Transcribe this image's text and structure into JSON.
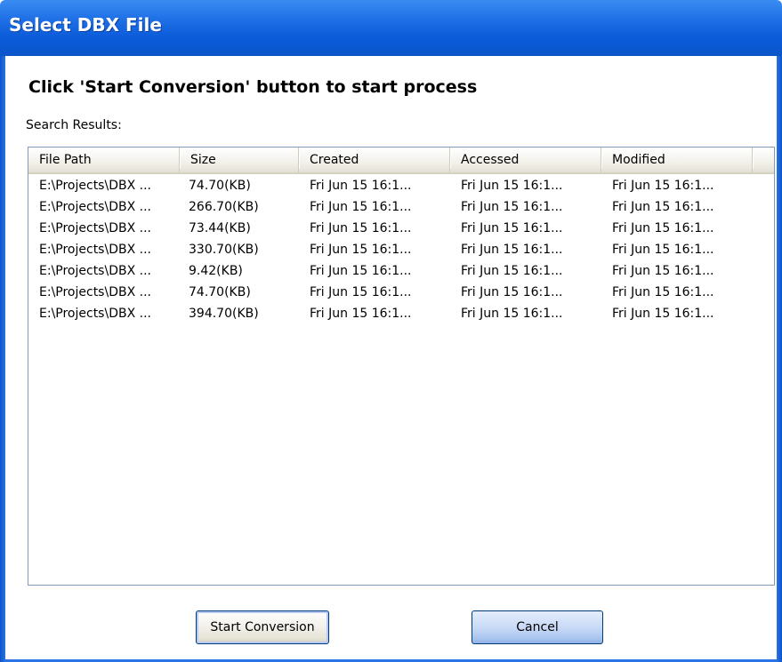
{
  "window": {
    "title": "Select DBX File"
  },
  "heading": "Click 'Start Conversion' button to start process",
  "search_label": "Search Results:",
  "table": {
    "columns": [
      "File Path",
      "Size",
      "Created",
      "Accessed",
      "Modified"
    ],
    "rows": [
      [
        "E:\\Projects\\DBX ...",
        "74.70(KB)",
        "Fri Jun 15 16:1...",
        "Fri Jun 15 16:1...",
        "Fri Jun 15 16:1..."
      ],
      [
        "E:\\Projects\\DBX ...",
        "266.70(KB)",
        "Fri Jun 15 16:1...",
        "Fri Jun 15 16:1...",
        "Fri Jun 15 16:1..."
      ],
      [
        "E:\\Projects\\DBX ...",
        "73.44(KB)",
        "Fri Jun 15 16:1...",
        "Fri Jun 15 16:1...",
        "Fri Jun 15 16:1..."
      ],
      [
        "E:\\Projects\\DBX ...",
        "330.70(KB)",
        "Fri Jun 15 16:1...",
        "Fri Jun 15 16:1...",
        "Fri Jun 15 16:1..."
      ],
      [
        "E:\\Projects\\DBX ...",
        "9.42(KB)",
        "Fri Jun 15 16:1...",
        "Fri Jun 15 16:1...",
        "Fri Jun 15 16:1..."
      ],
      [
        "E:\\Projects\\DBX ...",
        "74.70(KB)",
        "Fri Jun 15 16:1...",
        "Fri Jun 15 16:1...",
        "Fri Jun 15 16:1..."
      ],
      [
        "E:\\Projects\\DBX ...",
        "394.70(KB)",
        "Fri Jun 15 16:1...",
        "Fri Jun 15 16:1...",
        "Fri Jun 15 16:1..."
      ]
    ]
  },
  "buttons": {
    "start_label": "Start Conversion",
    "cancel_label": "Cancel"
  },
  "colors": {
    "titlebar": "#0a5ad9",
    "accent": "#2a74e6"
  }
}
